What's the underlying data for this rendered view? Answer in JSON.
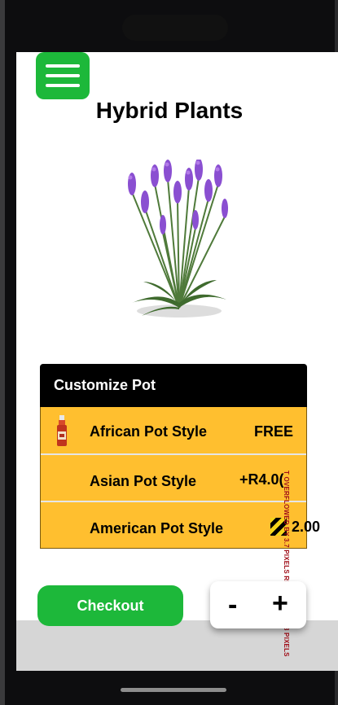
{
  "header": {
    "title": "Hybrid Plants"
  },
  "customize": {
    "heading": "Customize Pot",
    "options": [
      {
        "label": "African Pot Style",
        "price": "FREE"
      },
      {
        "label": "Asian Pot Style",
        "price": "+R4.0("
      },
      {
        "label": "American Pot Style",
        "price": "2.00"
      }
    ]
  },
  "overflow_warning": "T OVERFLOWED BY 3.7 PIXELS RFLOWED BY 43 PIXELS",
  "actions": {
    "checkout_label": "Checkout",
    "minus_label": "-",
    "plus_label": "+"
  },
  "colors": {
    "primary_green": "#1db83a",
    "option_yellow": "#ffbf2f",
    "header_black": "#000000"
  },
  "icons": {
    "menu": "hamburger-icon",
    "option_item": "sauce-bottle-icon"
  }
}
